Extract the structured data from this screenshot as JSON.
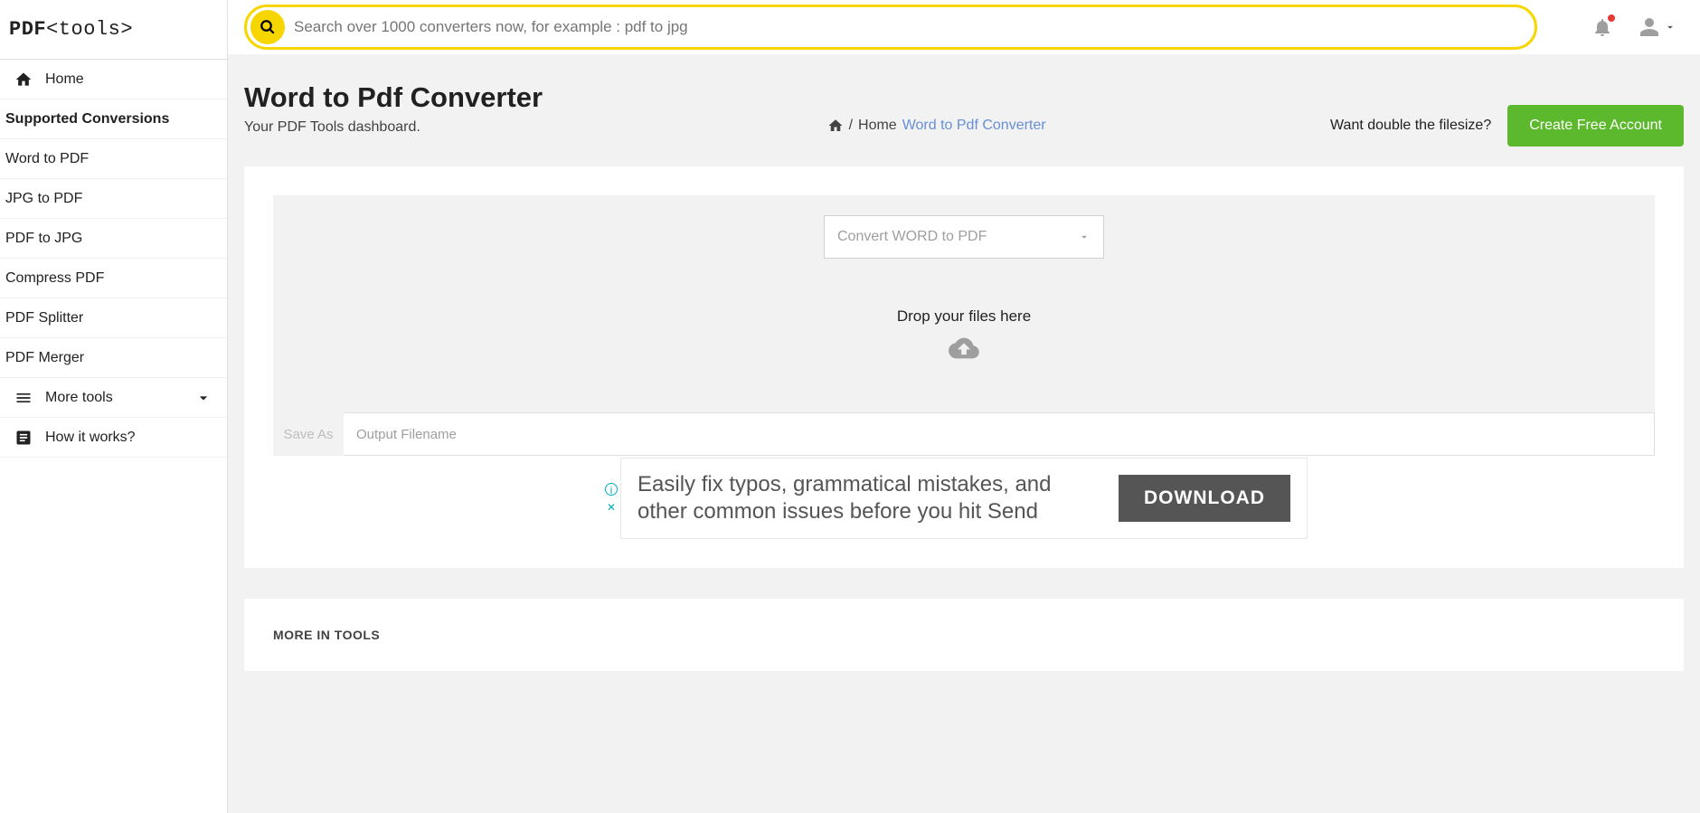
{
  "logo": {
    "bold": "PDF",
    "thin": "<tools>"
  },
  "search": {
    "placeholder": "Search over 1000 converters now, for example : pdf to jpg"
  },
  "sidebar": {
    "home": "Home",
    "section": "Supported Conversions",
    "items": [
      "Word to PDF",
      "JPG to PDF",
      "PDF to JPG",
      "Compress PDF",
      "PDF Splitter",
      "PDF Merger"
    ],
    "more": "More tools",
    "how": "How it works?"
  },
  "header": {
    "title": "Word to Pdf Converter",
    "subtitle": "Your PDF Tools dashboard.",
    "crumb_home": "Home",
    "crumb_current": "Word to Pdf Converter",
    "prompt": "Want double the filesize?",
    "cta": "Create Free Account"
  },
  "converter": {
    "select": "Convert WORD to PDF",
    "drop_msg": "Drop your files here",
    "saveas_label": "Save As",
    "saveas_placeholder": "Output Filename"
  },
  "ad": {
    "text": "Easily fix typos, grammatical mistakes, and other common issues before you hit Send",
    "button": "DOWNLOAD"
  },
  "more_section": {
    "title": "MORE IN TOOLS"
  }
}
